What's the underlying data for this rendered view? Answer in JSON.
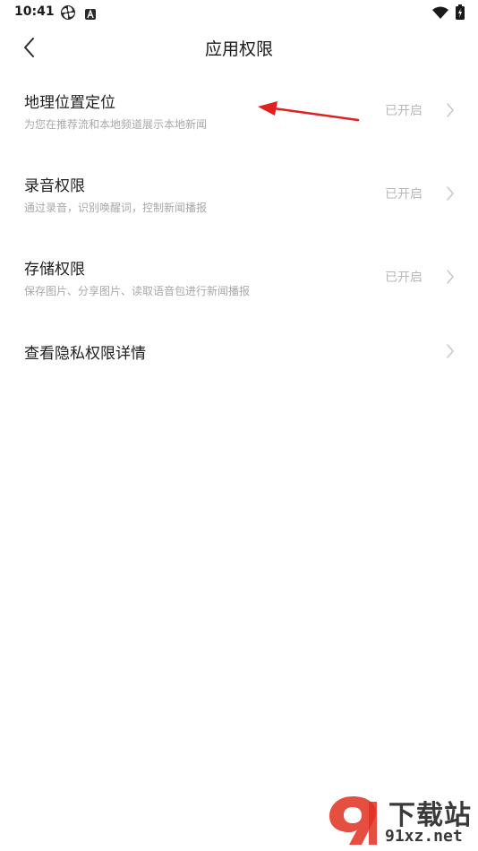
{
  "status_bar": {
    "time": "10:41",
    "icons": [
      "pinwheel-icon",
      "a-badge-icon",
      "wifi-icon",
      "battery-charging-icon"
    ]
  },
  "header": {
    "title": "应用权限",
    "back_icon": "chevron-left-icon"
  },
  "permissions": [
    {
      "title": "地理位置定位",
      "description": "为您在推荐流和本地频道展示本地新闻",
      "status": "已开启"
    },
    {
      "title": "录音权限",
      "description": "通过录音，识别唤醒词，控制新闻播报",
      "status": "已开启"
    },
    {
      "title": "存储权限",
      "description": "保存图片、分享图片、读取语音包进行新闻播报",
      "status": "已开启"
    },
    {
      "title": "查看隐私权限详情",
      "description": "",
      "status": ""
    }
  ],
  "annotation": {
    "arrow_color": "#e0201e"
  },
  "watermark": {
    "brand": "下载站",
    "domain": "91xz.net",
    "logo_mark": "9"
  },
  "colors": {
    "background": "#ffffff",
    "title_text": "#1f1f1f",
    "secondary_text": "#a8a8a8",
    "status_text": "#b8b8b8",
    "watermark_red": "#e0301e"
  }
}
